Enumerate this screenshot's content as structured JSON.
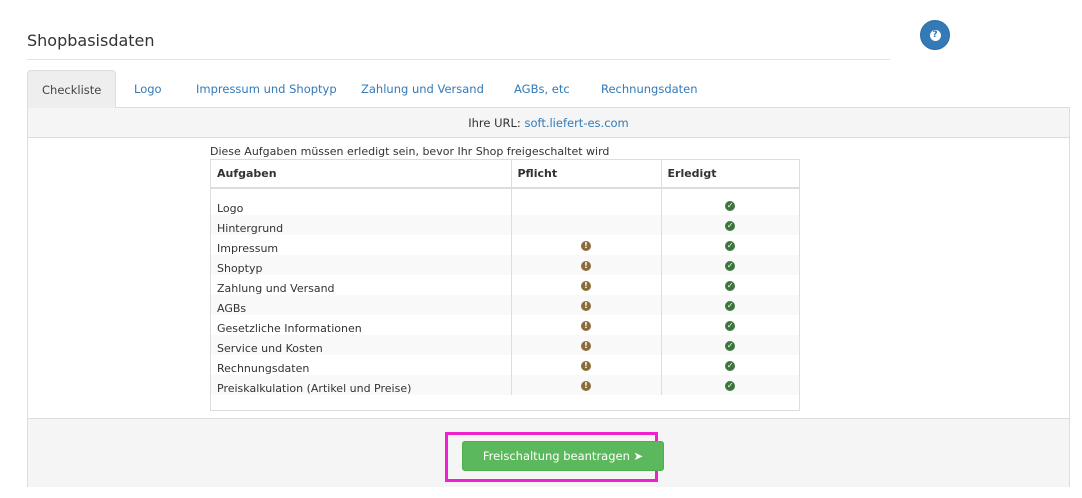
{
  "page": {
    "title": "Shopbasisdaten",
    "help_icon": "question-circle"
  },
  "tabs": [
    {
      "label": "Checkliste",
      "active": true
    },
    {
      "label": "Logo",
      "active": false
    },
    {
      "label": "Impressum und Shoptyp",
      "active": false
    },
    {
      "label": "Zahlung und Versand",
      "active": false
    },
    {
      "label": "AGBs, etc",
      "active": false
    },
    {
      "label": "Rechnungsdaten",
      "active": false
    }
  ],
  "url_bar": {
    "label": "Ihre URL:",
    "url": "soft.liefert-es.com"
  },
  "checklist": {
    "caption": "Diese Aufgaben müssen erledigt sein, bevor Ihr Shop freigeschaltet wird",
    "columns": [
      "Aufgaben",
      "Pflicht",
      "Erledigt"
    ],
    "rows": [
      {
        "task": "Logo",
        "required": false,
        "done": true
      },
      {
        "task": "Hintergrund",
        "required": false,
        "done": true
      },
      {
        "task": "Impressum",
        "required": true,
        "done": true
      },
      {
        "task": "Shoptyp",
        "required": true,
        "done": true
      },
      {
        "task": "Zahlung und Versand",
        "required": true,
        "done": true
      },
      {
        "task": "AGBs",
        "required": true,
        "done": true
      },
      {
        "task": "Gesetzliche Informationen",
        "required": true,
        "done": true
      },
      {
        "task": "Service und Kosten",
        "required": true,
        "done": true
      },
      {
        "task": "Rechnungsdaten",
        "required": true,
        "done": true
      },
      {
        "task": "Preiskalkulation (Artikel und Preise)",
        "required": true,
        "done": true
      }
    ]
  },
  "footer": {
    "submit_label": "Freischaltung beantragen",
    "submit_icon": "send-arrow"
  },
  "colors": {
    "accent": "#337ab7",
    "success": "#5cb85c",
    "highlight": "#ee22cc",
    "check": "#3c763d",
    "warn": "#8a6d3b"
  }
}
